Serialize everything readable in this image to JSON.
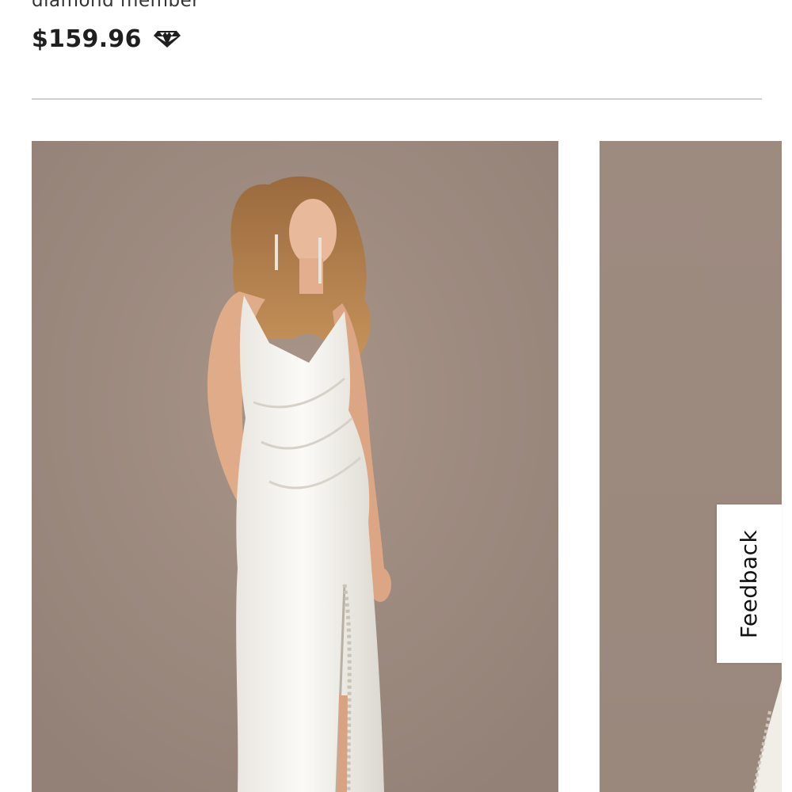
{
  "product": {
    "member_label": "diamond member",
    "price": "$159.96",
    "price_icon": "diamond-icon"
  },
  "gallery": {
    "images": [
      {
        "name": "main-product-image",
        "description_icon": "model-wedding-dress-photo"
      },
      {
        "name": "secondary-product-image",
        "description_icon": "model-wedding-dress-photo"
      }
    ],
    "background_color": "#9c8a80"
  },
  "feedback": {
    "label": "Feedback"
  },
  "colors": {
    "text_primary": "#1f1f1f",
    "divider": "#d0d0d0",
    "photo_backdrop": "#9c8a80"
  }
}
